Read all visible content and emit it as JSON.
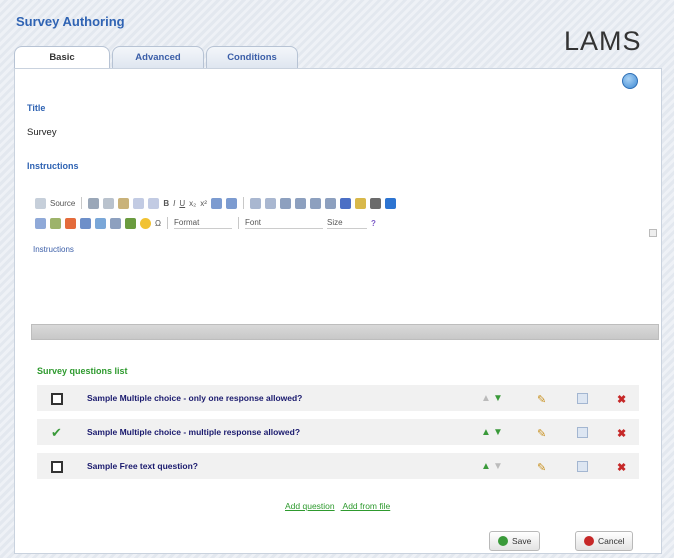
{
  "app": {
    "title": "Survey Authoring",
    "logo": "LAMS"
  },
  "tabs": [
    {
      "label": "Basic",
      "active": true
    },
    {
      "label": "Advanced",
      "active": false
    },
    {
      "label": "Conditions",
      "active": false
    }
  ],
  "form": {
    "title_label": "Title",
    "title_value": "Survey",
    "instructions_label": "Instructions",
    "instructions_value": "Instructions"
  },
  "editor": {
    "source_label": "Source",
    "format_select": "Format",
    "font_select": "Font",
    "size_select": "Size",
    "toolbar_icons": [
      "source-icon",
      "maximize-icon",
      "copy-icon",
      "paste-icon",
      "undo-icon",
      "redo-icon",
      "bold-icon",
      "italic-icon",
      "underline-icon",
      "subscript-icon",
      "superscript-icon",
      "numbered-list-icon",
      "bulleted-list-icon",
      "outdent-icon",
      "indent-icon",
      "align-left-icon",
      "align-center-icon",
      "align-right-icon",
      "justify-icon",
      "text-color-icon",
      "bg-color-icon",
      "spellcheck-icon",
      "image-icon"
    ],
    "toolbar_icons_row2": [
      "link-icon",
      "unlink-icon",
      "anchor-icon",
      "table-icon",
      "horizontal-rule-icon",
      "special-char-icon",
      "smiley-icon",
      "omega-icon"
    ]
  },
  "questions": {
    "title": "Survey questions list",
    "items": [
      {
        "type_icon": "multiple-choice-icon",
        "text": "Sample Multiple choice - only one response allowed?"
      },
      {
        "type_icon": "multiple-answers-icon",
        "text": "Sample Multiple choice - multiple response allowed?"
      },
      {
        "type_icon": "free-text-icon",
        "text": "Sample Free text question?"
      }
    ],
    "add_links": [
      "Add question",
      "Add from file"
    ]
  },
  "buttons": {
    "save": "Save",
    "cancel": "Cancel"
  },
  "colors": {
    "accent": "#2f63b3",
    "list_title": "#2e9a2e"
  }
}
